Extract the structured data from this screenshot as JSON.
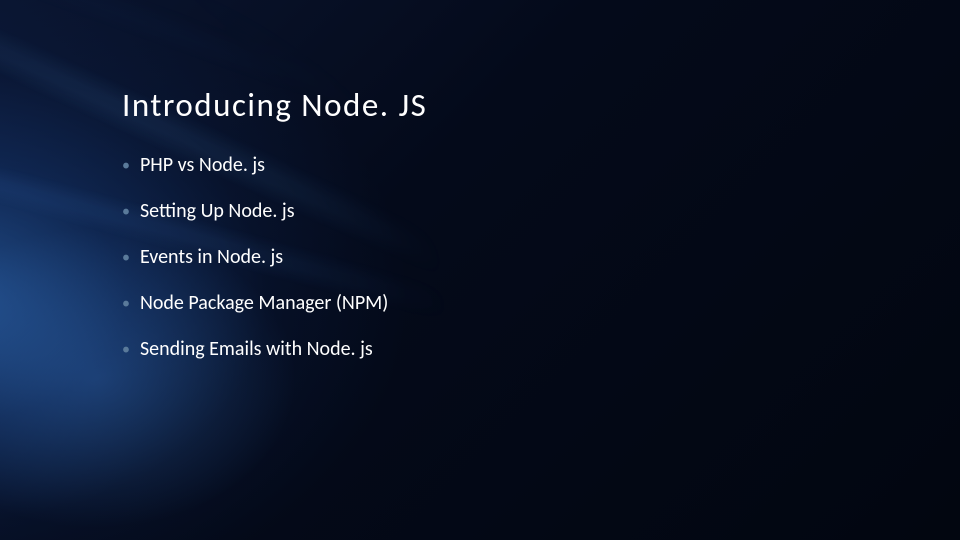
{
  "slide": {
    "title": "Introducing Node. JS",
    "bullets": [
      {
        "text": "PHP vs Node. js"
      },
      {
        "text": "Setting Up Node. js"
      },
      {
        "text": "Events in Node. js"
      },
      {
        "text": "Node Package Manager (NPM)"
      },
      {
        "text": "Sending Emails with Node. js"
      }
    ]
  }
}
